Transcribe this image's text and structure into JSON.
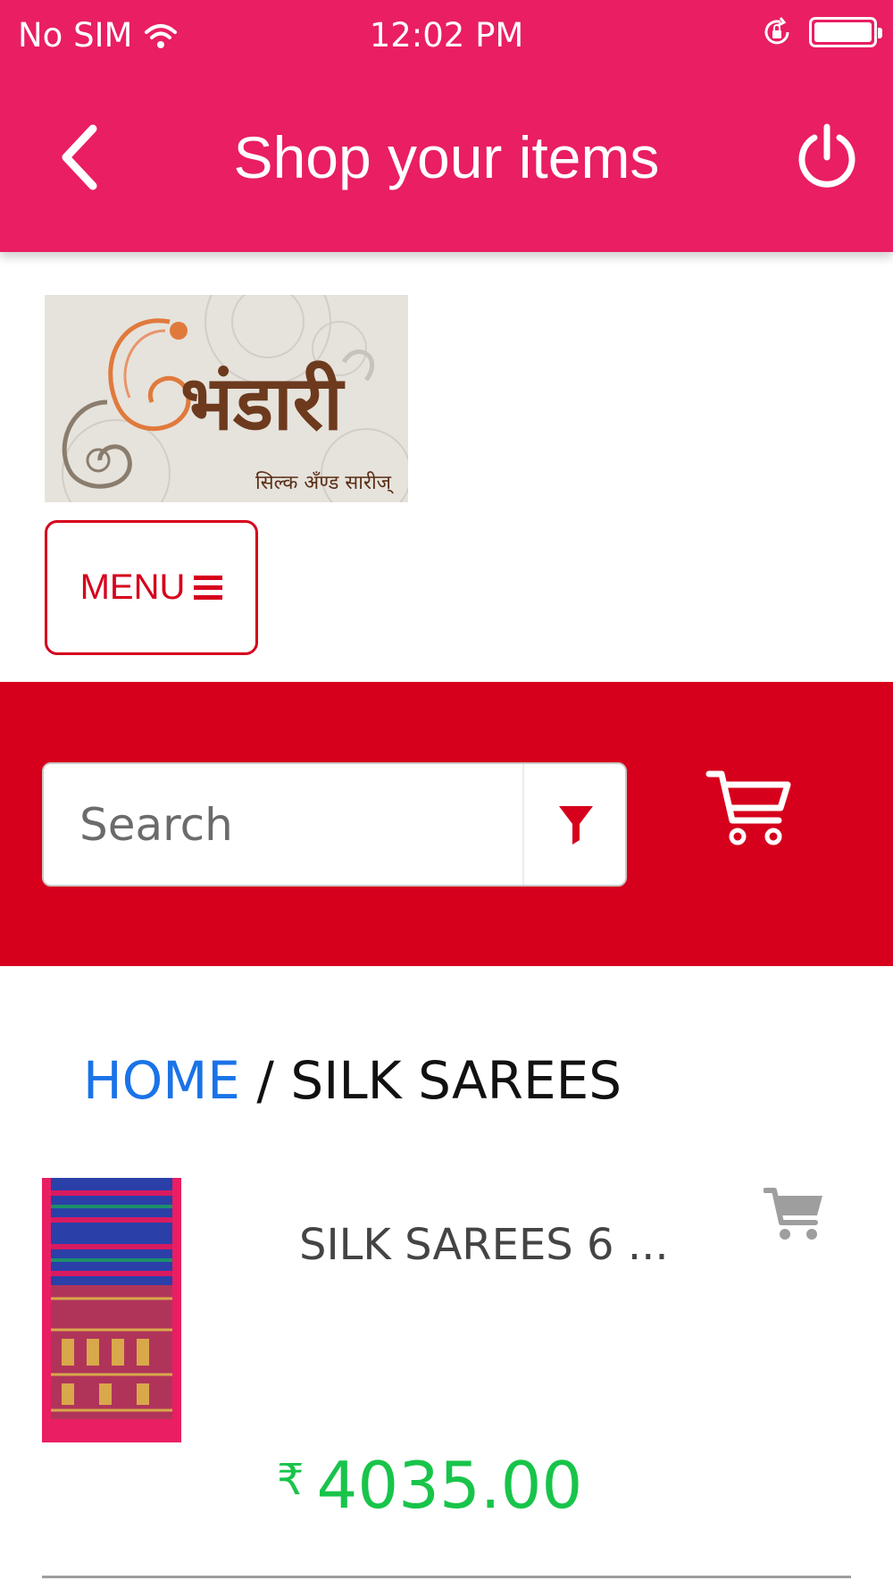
{
  "status_bar": {
    "carrier": "No SIM",
    "time": "12:02 PM",
    "icons": [
      "wifi-icon",
      "orientation-lock-icon",
      "battery-icon"
    ]
  },
  "app_bar": {
    "title": "Shop your items",
    "left_icon": "back-chevron-icon",
    "right_icon": "power-icon",
    "color": "#e91e63"
  },
  "logo": {
    "text": "भंडारी",
    "subtitle": "सिल्क अँण्ड सारीज्"
  },
  "menu_button": {
    "label": "MENU",
    "icon": "hamburger-icon",
    "color": "#d6001c"
  },
  "search": {
    "placeholder": "Search",
    "value": "",
    "filter_icon": "filter-icon",
    "cart_icon": "cart-icon",
    "band_color": "#d6001c"
  },
  "breadcrumb": {
    "home": "HOME",
    "separator": "/",
    "current": "SILK SAREES"
  },
  "products": [
    {
      "name": "SILK SAREES 6 ...",
      "currency": "₹",
      "price": "4035.00",
      "price_color": "#18c44a",
      "action_icon": "add-to-cart-icon"
    }
  ]
}
